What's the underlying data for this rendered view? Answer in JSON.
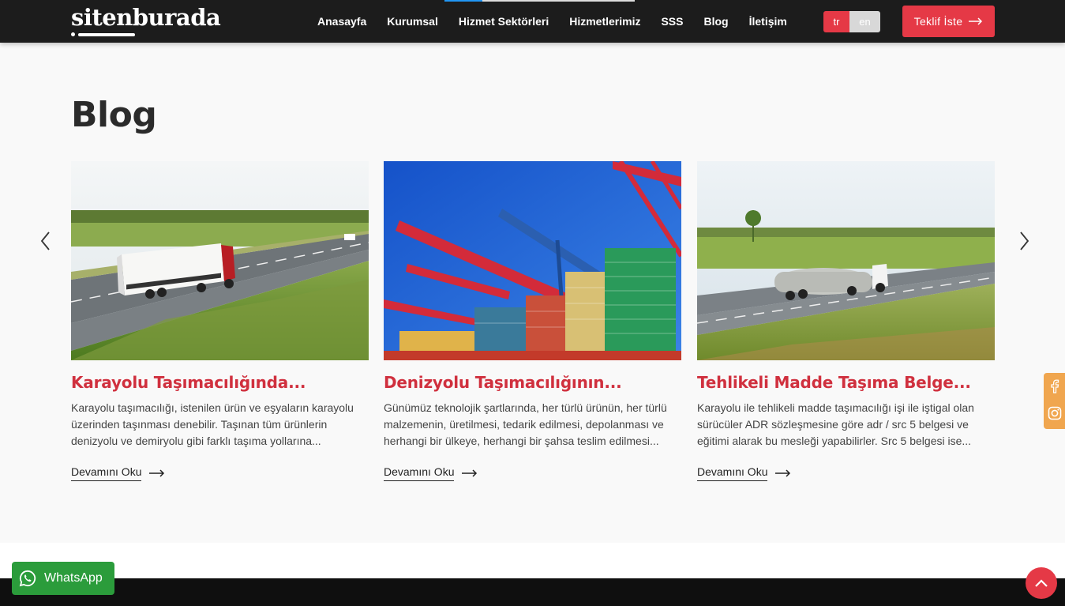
{
  "header": {
    "logo_text": "sitenburada",
    "nav": [
      "Anasayfa",
      "Kurumsal",
      "Hizmet Sektörleri",
      "Hizmetlerimiz",
      "SSS",
      "Blog",
      "İletişim"
    ],
    "lang_tr": "tr",
    "lang_en": "en",
    "quote_button": "Teklif İste"
  },
  "main": {
    "title": "Blog",
    "cards": [
      {
        "title": "Karayolu Taşımacılığında...",
        "text": "Karayolu taşımacılığı, istenilen ürün ve eşyaların karayolu üzerinden taşınması denebilir. Taşınan tüm ürünlerin denizyolu ve demiryolu gibi farklı taşıma yollarına...",
        "link": "Devamını Oku",
        "image": "truck-on-highway"
      },
      {
        "title": "Denizyolu Taşımacılığının...",
        "text": "Günümüz teknolojik şartlarında, her türlü ürünün, her türlü malzemenin, üretilmesi, tedarik edilmesi, depolanması ve herhangi bir  ülkeye, herhangi bir şahsa teslim edilmesi...",
        "link": "Devamını Oku",
        "image": "port-cranes-containers"
      },
      {
        "title": "Tehlikeli Madde Taşıma Belge...",
        "text": "Karayolu ile tehlikeli madde taşımacılığı işi ile iştigal olan sürücüler ADR sözleşmesine göre adr / src 5 belgesi ve eğitimi alarak bu mesleği yapabilirler. Src 5 belgesi ise...",
        "link": "Devamını Oku",
        "image": "tanker-truck-on-highway"
      }
    ]
  },
  "whatsapp_label": "WhatsApp",
  "colors": {
    "accent": "#e53946",
    "header_bg": "#1c1c1c",
    "card_title": "#d0303e",
    "whatsapp": "#2b9c3b",
    "social_bar": "#f0a64f"
  },
  "icons": [
    "chevron-left-icon",
    "chevron-right-icon",
    "arrow-right-icon",
    "facebook-icon",
    "instagram-icon",
    "whatsapp-icon",
    "chevron-up-icon"
  ]
}
